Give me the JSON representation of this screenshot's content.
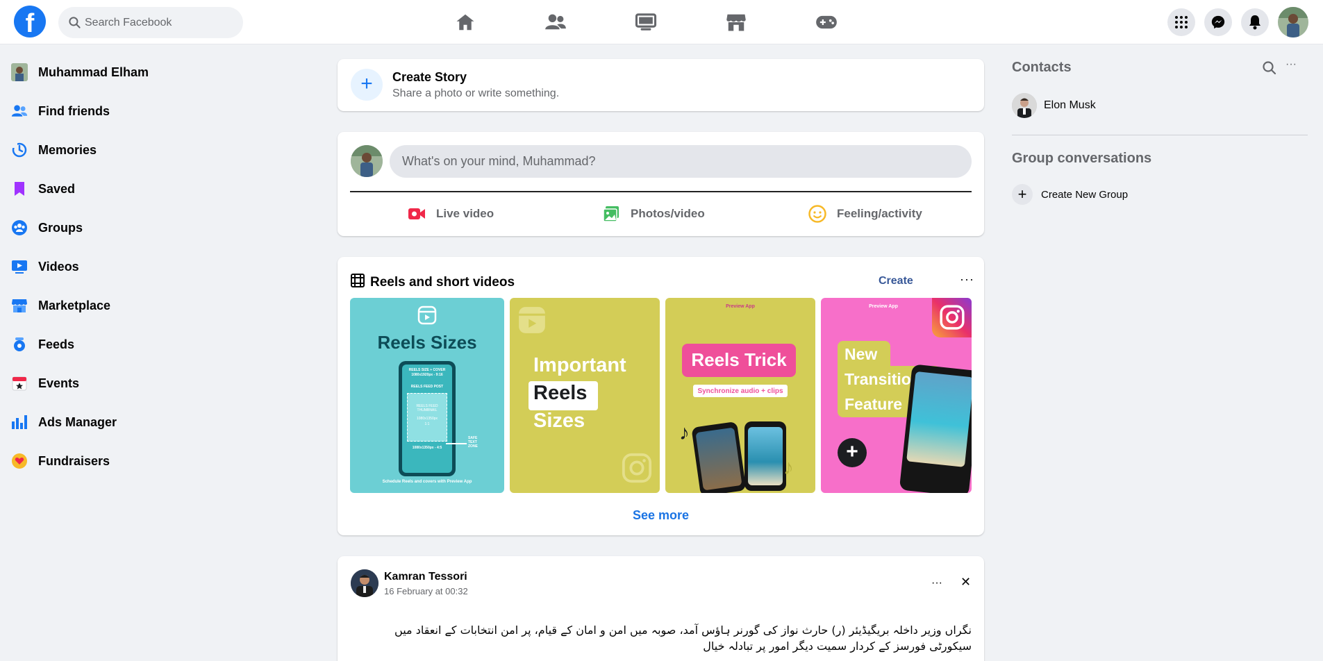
{
  "topbar": {
    "logo_letter": "f",
    "search_placeholder": "Search Facebook",
    "nav": [
      "home-icon",
      "friends-icon",
      "watch-icon",
      "marketplace-icon",
      "gaming-icon"
    ],
    "right": [
      "menu-grid-icon",
      "messenger-icon",
      "notifications-icon",
      "profile-avatar"
    ]
  },
  "sidebar": {
    "items": [
      {
        "label": "Muhammad Elham",
        "icon": "profile-avatar",
        "color": "#8a9a7b"
      },
      {
        "label": "Find friends",
        "icon": "friends-icon",
        "color": "#1877f2"
      },
      {
        "label": "Memories",
        "icon": "memories-icon",
        "color": "#1877f2"
      },
      {
        "label": "Saved",
        "icon": "saved-icon",
        "color": "#a033ff"
      },
      {
        "label": "Groups",
        "icon": "groups-icon",
        "color": "#1877f2"
      },
      {
        "label": "Videos",
        "icon": "videos-icon",
        "color": "#1877f2"
      },
      {
        "label": "Marketplace",
        "icon": "marketplace-icon",
        "color": "#1877f2"
      },
      {
        "label": "Feeds",
        "icon": "feeds-icon",
        "color": "#1877f2"
      },
      {
        "label": "Events",
        "icon": "events-icon",
        "color": "#f02849"
      },
      {
        "label": "Ads Manager",
        "icon": "ads-manager-icon",
        "color": "#1877f2"
      },
      {
        "label": "Fundraisers",
        "icon": "fundraisers-icon",
        "color": "#f7b928"
      }
    ]
  },
  "story": {
    "plus": "+",
    "title": "Create Story",
    "subtitle": "Share a photo or write something."
  },
  "composer": {
    "placeholder": "What's on your mind, Muhammad?",
    "actions": [
      {
        "label": "Live video",
        "icon": "live-video-icon",
        "color": "#f02849"
      },
      {
        "label": "Photos/video",
        "icon": "photos-icon",
        "color": "#45bd62"
      },
      {
        "label": "Feeling/activity",
        "icon": "feeling-icon",
        "color": "#f7b928"
      }
    ]
  },
  "reels": {
    "title": "Reels and short videos",
    "create_label": "Create",
    "more": "···",
    "see_more": "See more",
    "items": [
      {
        "bg": "#6ccfd4",
        "title": "Reels Sizes",
        "phone_head": "REELS SIZE + COVER",
        "phone_size": "1080x1920px - 9:16",
        "phone_sub": "REELS FEED POST",
        "phone_thumb": "REELS FEED THUMBNAIL",
        "phone_thumb_size": "1080x1350px",
        "phone_thumb_ratio": "1:1",
        "phone_bottom": "1080x1350px - 4:5",
        "safe": "SAFE TEXT ZONE",
        "footer": "Schedule Reels and covers with Preview App"
      },
      {
        "bg": "#d3cd57",
        "line1": "Important",
        "line2": "Reels",
        "line3": "Sizes"
      },
      {
        "bg": "#d3cd57",
        "brand": "Preview App",
        "title": "Reels Trick",
        "sub": "Synchronize audio + clips"
      },
      {
        "bg": "#f76fc9",
        "brand": "Preview App",
        "line1": "New",
        "line2": "Transition",
        "line3": "Feature"
      }
    ]
  },
  "feed": {
    "name": "Kamran Tessori",
    "time": "16 February at 00:32",
    "more": "···",
    "close": "✕",
    "text": "نگراں وزیر داخلہ بریگیڈیئر (ر) حارث نواز کی گورنر ہاؤس آمد، صوبہ میں امن و امان کے قیام، پر امن انتخابات کے انعقاد میں سیکورٹی فورسز کے کردار سمیت دیگر امور پر تبادلہ خیال"
  },
  "contacts": {
    "title": "Contacts",
    "more": "···",
    "list": [
      {
        "name": "Elon Musk"
      }
    ],
    "group_title": "Group conversations",
    "create_group_icon": "+",
    "create_group": "Create New Group"
  }
}
